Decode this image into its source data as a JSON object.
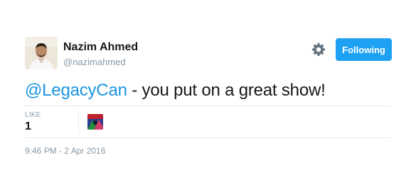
{
  "author": {
    "display_name": "Nazim Ahmed",
    "screen_name": "@nazimahmed",
    "avatar_icon": "user-avatar"
  },
  "actions": {
    "settings_icon": "gear-icon",
    "follow_label": "Following",
    "follow_color": "#1da1f2"
  },
  "tweet": {
    "mention": "@LegacyCan",
    "text": " - you put on a great show!",
    "mention_color": "#1b95e0"
  },
  "stats": {
    "like_label": "LIKE",
    "like_count": "1",
    "liker_avatar_icon": "liker-avatar"
  },
  "timestamp": "9:46 PM - 2 Apr 2016"
}
